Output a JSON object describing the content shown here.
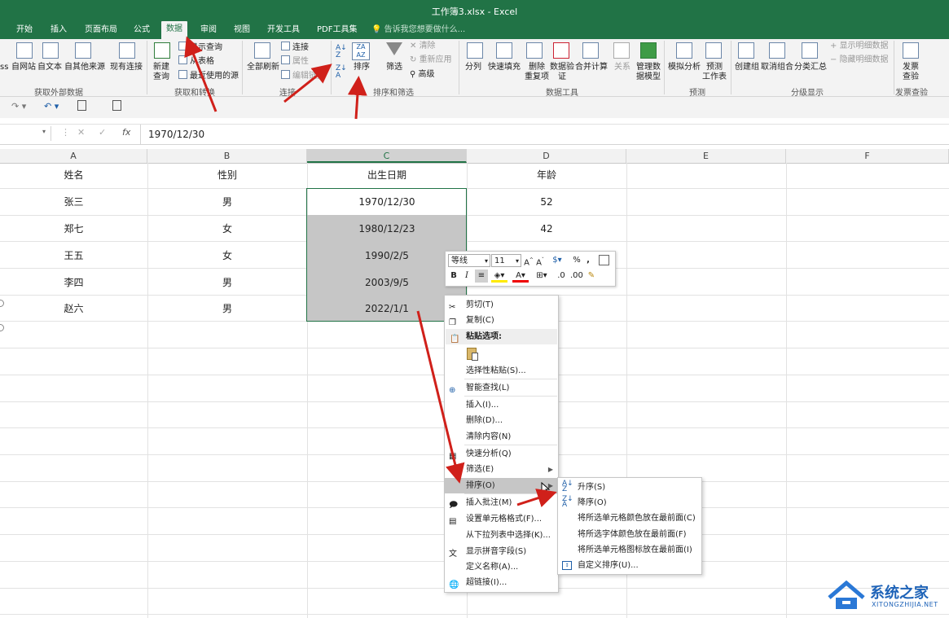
{
  "window": {
    "title": "工作簿3.xlsx - Excel"
  },
  "tabs": [
    {
      "label": "开始"
    },
    {
      "label": "插入"
    },
    {
      "label": "页面布局"
    },
    {
      "label": "公式"
    },
    {
      "label": "数据"
    },
    {
      "label": "审阅"
    },
    {
      "label": "视图"
    },
    {
      "label": "开发工具"
    },
    {
      "label": "PDF工具集"
    }
  ],
  "tell_me": "告诉我您想要做什么...",
  "ribbon": {
    "get_external": {
      "label": "获取外部数据",
      "items": [
        "ss",
        "自网站",
        "自文本",
        "自其他来源",
        "现有连接"
      ]
    },
    "get_transform": {
      "label": "获取和转换",
      "new_query": "新建\n查询",
      "show_query": "显示查询",
      "from_table": "从表格",
      "recent": "最近使用的源"
    },
    "connections": {
      "label": "连接",
      "refresh_all": "全部刷新",
      "connections": "连接",
      "properties": "属性",
      "edit_links": "编辑链接"
    },
    "sort_filter": {
      "label": "排序和筛选",
      "sort": "排序",
      "filter": "筛选",
      "clear": "清除",
      "reapply": "重新应用",
      "advanced": "高级"
    },
    "data_tools": {
      "label": "数据工具",
      "items": [
        "分列",
        "快速填充",
        "删除\n重复项",
        "数据验\n证",
        "合并计算",
        "关系",
        "管理数\n据模型"
      ]
    },
    "forecast": {
      "label": "预测",
      "items": [
        "模拟分析",
        "预测\n工作表"
      ]
    },
    "outline": {
      "label": "分级显示",
      "items": [
        "创建组",
        "取消组合",
        "分类汇总"
      ],
      "show_detail": "显示明细数据",
      "hide_detail": "隐藏明细数据"
    },
    "invoice": {
      "label": "发票查验",
      "item": "发票\n查验"
    }
  },
  "formula_bar": {
    "name_box": "",
    "fx": "fx",
    "value": "1970/12/30"
  },
  "columns": [
    "A",
    "B",
    "C",
    "D",
    "E",
    "F"
  ],
  "sheet": {
    "header": [
      "姓名",
      "性别",
      "出生日期",
      "年龄"
    ],
    "rows": [
      [
        "张三",
        "男",
        "1970/12/30",
        "52"
      ],
      [
        "郑七",
        "女",
        "1980/12/23",
        "42"
      ],
      [
        "王五",
        "女",
        "1990/2/5",
        ""
      ],
      [
        "李四",
        "男",
        "2003/9/5",
        ""
      ],
      [
        "赵六",
        "男",
        "2022/1/1",
        ""
      ]
    ]
  },
  "mini_toolbar": {
    "font": "等线",
    "size": "11"
  },
  "context_menu": {
    "cut": "剪切(T)",
    "copy": "复制(C)",
    "paste_options": "粘贴选项:",
    "paste_special": "选择性粘贴(S)...",
    "smart_lookup": "智能查找(L)",
    "insert": "插入(I)...",
    "delete": "删除(D)...",
    "clear": "清除内容(N)",
    "quick_analysis": "快速分析(Q)",
    "filter": "筛选(E)",
    "sort": "排序(O)",
    "insert_comment": "插入批注(M)",
    "format_cells": "设置单元格格式(F)...",
    "pick_list": "从下拉列表中选择(K)...",
    "phonetic": "显示拼音字段(S)",
    "define_name": "定义名称(A)...",
    "hyperlink": "超链接(I)..."
  },
  "sort_submenu": {
    "asc": "升序(S)",
    "desc": "降序(O)",
    "cell_color": "将所选单元格颜色放在最前面(C)",
    "font_color": "将所选字体颜色放在最前面(F)",
    "cell_icon": "将所选单元格图标放在最前面(I)",
    "custom": "自定义排序(U)..."
  },
  "watermark": {
    "title": "系统之家",
    "url": "XITONGZHIJIA.NET"
  },
  "colors": {
    "excel_green": "#217346",
    "annotation_red": "#d0201a",
    "selection_grey": "#c6c6c6"
  }
}
